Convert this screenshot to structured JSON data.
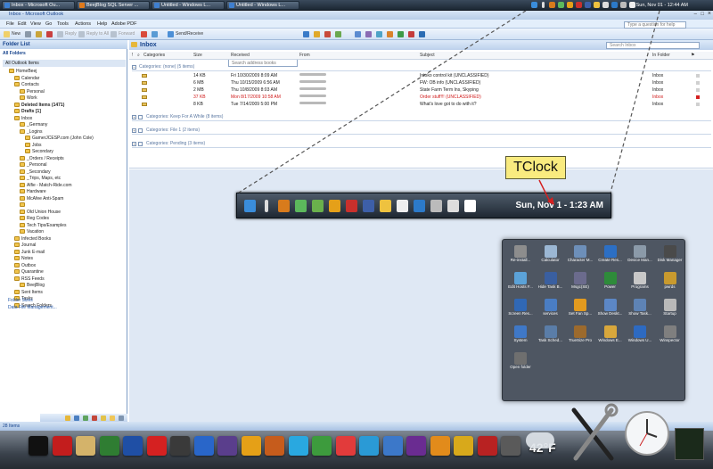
{
  "top_taskbar": {
    "tasks": [
      "Inbox - Microsoft Ou...",
      "BeejBlog SQL Server ...",
      "Untitled - Windows L...",
      "Untitled - Windows L..."
    ],
    "clock": "Sun, Nov 01 - 12:44 AM"
  },
  "window": {
    "title": "Inbox - Microsoft Outlook",
    "menu": [
      "File",
      "Edit",
      "View",
      "Go",
      "Tools",
      "Actions",
      "Help",
      "Adobe PDF"
    ],
    "help_placeholder": "Type a question for help",
    "toolbar": {
      "new": "New",
      "reply": "Reply",
      "reply_all": "Reply to All",
      "forward": "Forward",
      "send_receive": "Send/Receive",
      "search_address": "Search address books"
    }
  },
  "folder_pane": {
    "title": "Folder List",
    "all_folders": "All Folders",
    "all_items": "All Outlook Items",
    "folders": [
      {
        "label": "HomeBeej",
        "level": 1,
        "bold": false
      },
      {
        "label": "Calendar",
        "level": 2
      },
      {
        "label": "Contacts",
        "level": 2
      },
      {
        "label": "Personal",
        "level": 3
      },
      {
        "label": "Work",
        "level": 3
      },
      {
        "label": "Deleted Items (1471)",
        "level": 2,
        "bold": true
      },
      {
        "label": "Drafts [1]",
        "level": 2,
        "bold": true
      },
      {
        "label": "Inbox",
        "level": 2
      },
      {
        "label": "_Germany",
        "level": 3
      },
      {
        "label": "_Logins",
        "level": 3
      },
      {
        "label": "GamerJCESP.com (John Cole)",
        "level": 4
      },
      {
        "label": "Jobs",
        "level": 4
      },
      {
        "label": "Secondary",
        "level": 4
      },
      {
        "label": "_Orders / Receipts",
        "level": 3
      },
      {
        "label": "_Personal",
        "level": 3
      },
      {
        "label": "_Secondary",
        "level": 3
      },
      {
        "label": "_Trips, Maps, etc",
        "level": 3
      },
      {
        "label": "Alfie - Match-Ride.com",
        "level": 3
      },
      {
        "label": "Hardware",
        "level": 3
      },
      {
        "label": "McAfee Anti-Spam",
        "level": 3
      },
      {
        "label": "",
        "level": 3
      },
      {
        "label": "Old Union House",
        "level": 3
      },
      {
        "label": "Reg Codes",
        "level": 3
      },
      {
        "label": "Tech Tips/Examples",
        "level": 3
      },
      {
        "label": "Vacation",
        "level": 3
      },
      {
        "label": "Infected Books",
        "level": 2
      },
      {
        "label": "Journal",
        "level": 2
      },
      {
        "label": "Junk E-mail",
        "level": 2
      },
      {
        "label": "Notes",
        "level": 2
      },
      {
        "label": "Outbox",
        "level": 2
      },
      {
        "label": "Quarantine",
        "level": 2
      },
      {
        "label": "RSS Feeds",
        "level": 2
      },
      {
        "label": "BeejBlog",
        "level": 3
      },
      {
        "label": "Sent Items",
        "level": 2
      },
      {
        "label": "Tasks",
        "level": 2
      },
      {
        "label": "Search Folders",
        "level": 2
      }
    ],
    "links": [
      "Folder Sizes",
      "Data File Management..."
    ]
  },
  "inbox": {
    "title": "Inbox",
    "search_placeholder": "Search Inbox",
    "columns": [
      "Categories",
      "Size",
      "Received",
      "From",
      "Subject",
      "In Folder"
    ],
    "group1": "Categories: (none) (5 items)",
    "rows": [
      {
        "size": "14 KB",
        "received": "Fri 10/30/2009 8:09 AM",
        "subject": "Intoko control kit (UNCLASSIFIED)",
        "folder": "Inbox",
        "red": false
      },
      {
        "size": "6 MB",
        "received": "Thu 10/15/2009 6:56 AM",
        "subject": "FW: OB info (UNCLASSIFIED)",
        "folder": "Inbox",
        "red": false
      },
      {
        "size": "2 MB",
        "received": "Thu 10/8/2009 8:03 AM",
        "subject": "State Farm Term Ins, Skyping",
        "folder": "Inbox",
        "red": false
      },
      {
        "size": "37 KB",
        "received": "Mon 8/17/2009 10:58 AM",
        "subject": "Order stuff!!! (UNCLASSIFIED)",
        "folder": "Inbox",
        "red": true
      },
      {
        "size": "8 KB",
        "received": "Tue 7/14/2009 5:00 PM",
        "subject": "What's love got to do with it?",
        "folder": "Inbox",
        "red": false
      }
    ],
    "group2": "Categories: Keep For A While (8 items)",
    "group3": "Categories: File 1 (2 items)",
    "group4": "Categories: Pending (3 items)"
  },
  "status_bar": "28 Items",
  "callout": {
    "label": "TClock",
    "clock": "Sun, Nov 1 - 1:23 AM"
  },
  "apps_panel": {
    "items": [
      "Re-install...",
      "Calculator",
      "Character M...",
      "Create Res...",
      "Device Man...",
      "Disk Manager",
      "Edit Hosts F...",
      "Hide Task B...",
      "Msgc(SE)",
      "Power",
      "Programs",
      "pwrds",
      "Screen Res...",
      "services",
      "Set Fan Sp...",
      "Show Deskt...",
      "Show Task...",
      "Startup",
      "System",
      "Task Sched...",
      "TrueSize Pro",
      "Windows E...",
      "Windows U...",
      "Winspector",
      "Open folder"
    ],
    "icon_colors": [
      "#8d8d8d",
      "#9bb7d4",
      "#6d8fb9",
      "#2c6fc4",
      "#8b9aa9",
      "#4a4a4a",
      "#5ba2d8",
      "#3a5fa0",
      "#6b6b8d",
      "#2e8b3a",
      "#c8c8c8",
      "#c99a2e",
      "#3068b5",
      "#4a7dc3",
      "#e29a1f",
      "#5c87c6",
      "#5e83b5",
      "#b9b9b9",
      "#3f78c7",
      "#5a7da8",
      "#9c6a2d",
      "#d8a73c",
      "#2d6ac1",
      "#7f7f7f",
      "#6f6f6f"
    ]
  },
  "dock": {
    "temperature": "42°F",
    "icon_colors": [
      "#111",
      "#c31d1d",
      "#d4b36a",
      "#2f7d32",
      "#1f4fa5",
      "#d52121",
      "#3a3a3a",
      "#2966c9",
      "#5a3e8c",
      "#e5a017",
      "#c65c1c",
      "#29a8e0",
      "#3d9b3d",
      "#e23b3b",
      "#2a9ad6",
      "#3c78c9",
      "#6a2c91",
      "#e28b1b",
      "#d8a91b",
      "#b82222",
      "#5a5a5a"
    ]
  }
}
